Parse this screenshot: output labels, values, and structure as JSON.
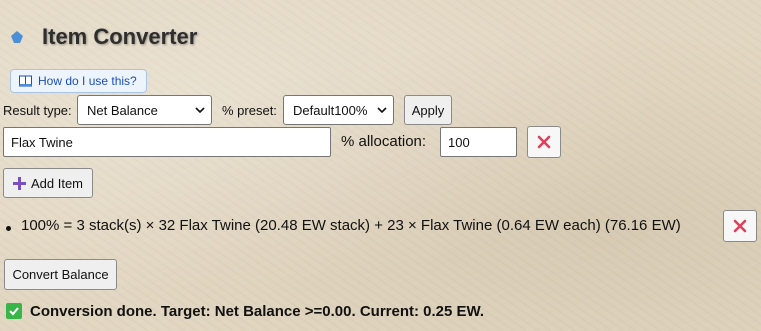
{
  "header": {
    "title": "Item Converter",
    "title_icon": "blue-diamond-icon"
  },
  "help": {
    "label": "How do I use this?",
    "icon": "book-icon"
  },
  "controls": {
    "result_type_label": "Result type:",
    "result_type_value": "Net Balance",
    "preset_label": "% preset:",
    "preset_value": "Default100%",
    "apply_label": "Apply"
  },
  "item_row": {
    "item_value": "Flax Twine",
    "allocation_label": "% allocation:",
    "allocation_value": "100",
    "remove_icon": "close-icon"
  },
  "add_item": {
    "label": "Add Item",
    "icon": "plus-icon"
  },
  "results": [
    {
      "text": "100% = 3 stack(s) × 32 Flax Twine (20.48 EW stack) + 23 × Flax Twine (0.64 EW each) (76.16 EW)"
    }
  ],
  "convert": {
    "label": "Convert Balance"
  },
  "status": {
    "text": "Conversion done. Target: Net Balance >=0.00. Current: 0.25 EW.",
    "icon": "check-mark-icon"
  },
  "colors": {
    "accent_blue": "#4a8fd8",
    "remove_red": "#e0405a",
    "success_green": "#39b54a",
    "plus_purple": "#7a4fc2"
  }
}
